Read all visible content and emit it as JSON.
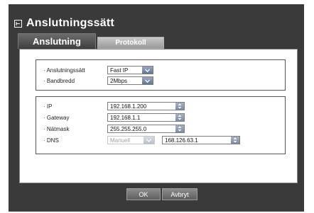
{
  "window": {
    "title": "Anslutningssätt"
  },
  "icons": {
    "title_icon": "network-icon",
    "dropdown_arrow": "chevron-down-icon",
    "spin": "spin-updown-icon"
  },
  "tabs": [
    {
      "label": "Anslutning",
      "active": true
    },
    {
      "label": "Protokoll",
      "active": false
    }
  ],
  "connection": {
    "type_label": "· Anslutningssätt",
    "type_value": "Fast IP",
    "bandwidth_label": "· Bandbredd",
    "bandwidth_value": "2Mbps"
  },
  "network": {
    "ip_label": "· IP",
    "ip_value": "192.168.1.200",
    "gateway_label": "· Gateway",
    "gateway_value": "192.168.1.1",
    "netmask_label": "· Nätmask",
    "netmask_value": "255.255.255.0",
    "dns_label": "· DNS",
    "dns_mode_value": "Manuell",
    "dns_value": "168.126.63.1"
  },
  "buttons": {
    "ok": "OK",
    "cancel": "Avbryt"
  },
  "colors": {
    "frame": "#3a3a3a",
    "dropdown_accent": "#5f7796",
    "panel": "#ffffff"
  }
}
